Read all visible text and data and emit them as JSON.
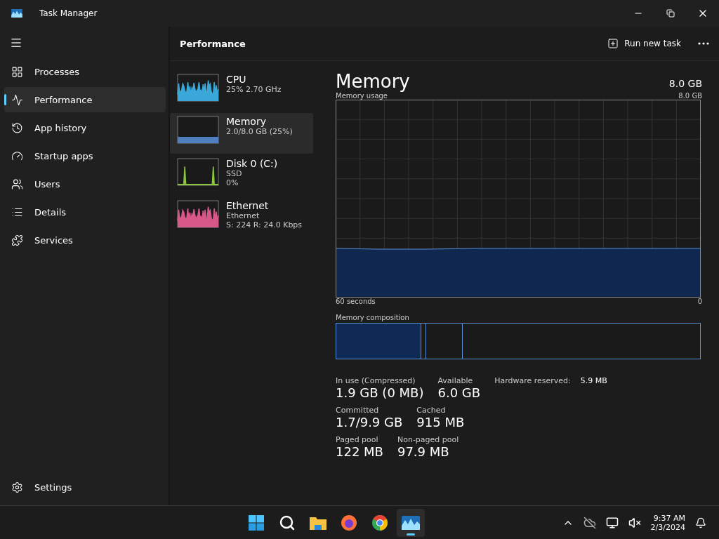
{
  "window": {
    "title": "Task Manager"
  },
  "sidebar": {
    "items": [
      {
        "label": "Processes",
        "selected": false
      },
      {
        "label": "Performance",
        "selected": true
      },
      {
        "label": "App history",
        "selected": false
      },
      {
        "label": "Startup apps",
        "selected": false
      },
      {
        "label": "Users",
        "selected": false
      },
      {
        "label": "Details",
        "selected": false
      },
      {
        "label": "Services",
        "selected": false
      }
    ],
    "settings": "Settings"
  },
  "header": {
    "title": "Performance",
    "run_new_task": "Run new task"
  },
  "devices": [
    {
      "name": "CPU",
      "lines": [
        "25%  2.70 GHz"
      ],
      "color": "#3aa8d8",
      "kind": "spiky",
      "selected": false
    },
    {
      "name": "Memory",
      "lines": [
        "2.0/8.0 GB (25%)"
      ],
      "color": "#4f7fc0",
      "kind": "flat",
      "selected": true
    },
    {
      "name": "Disk 0 (C:)",
      "lines": [
        "SSD",
        "0%"
      ],
      "color": "#8cc63e",
      "kind": "sparse",
      "selected": false
    },
    {
      "name": "Ethernet",
      "lines": [
        "Ethernet",
        "S: 224  R: 24.0 Kbps"
      ],
      "color": "#d8588a",
      "kind": "spiky",
      "selected": false
    }
  ],
  "detail": {
    "title": "Memory",
    "total": "8.0 GB",
    "usage_label": "Memory usage",
    "usage_max": "8.0 GB",
    "time_label": "60 seconds",
    "min_label": "0",
    "composition_label": "Memory composition",
    "stats": [
      [
        {
          "kind": "stacked",
          "label": "In use (Compressed)",
          "value": "1.9 GB (0 MB)"
        },
        {
          "kind": "stacked",
          "label": "Available",
          "value": "6.0 GB"
        },
        {
          "kind": "inline",
          "label": "Hardware reserved:",
          "value": "5.9 MB"
        }
      ],
      [
        {
          "kind": "stacked",
          "label": "Committed",
          "value": "1.7/9.9 GB"
        },
        {
          "kind": "stacked",
          "label": "Cached",
          "value": "915 MB"
        }
      ],
      [
        {
          "kind": "stacked",
          "label": "Paged pool",
          "value": "122 MB"
        },
        {
          "kind": "stacked",
          "label": "Non-paged pool",
          "value": "97.9 MB"
        }
      ]
    ]
  },
  "taskbar": {
    "apps": [
      {
        "kind": "start",
        "selected": false
      },
      {
        "kind": "search",
        "selected": false
      },
      {
        "kind": "files",
        "selected": false
      },
      {
        "kind": "firefox",
        "selected": false
      },
      {
        "kind": "chrome",
        "selected": false
      },
      {
        "kind": "taskmanager",
        "selected": true
      }
    ],
    "time": "9:37 AM",
    "date": "2/3/2024"
  }
}
